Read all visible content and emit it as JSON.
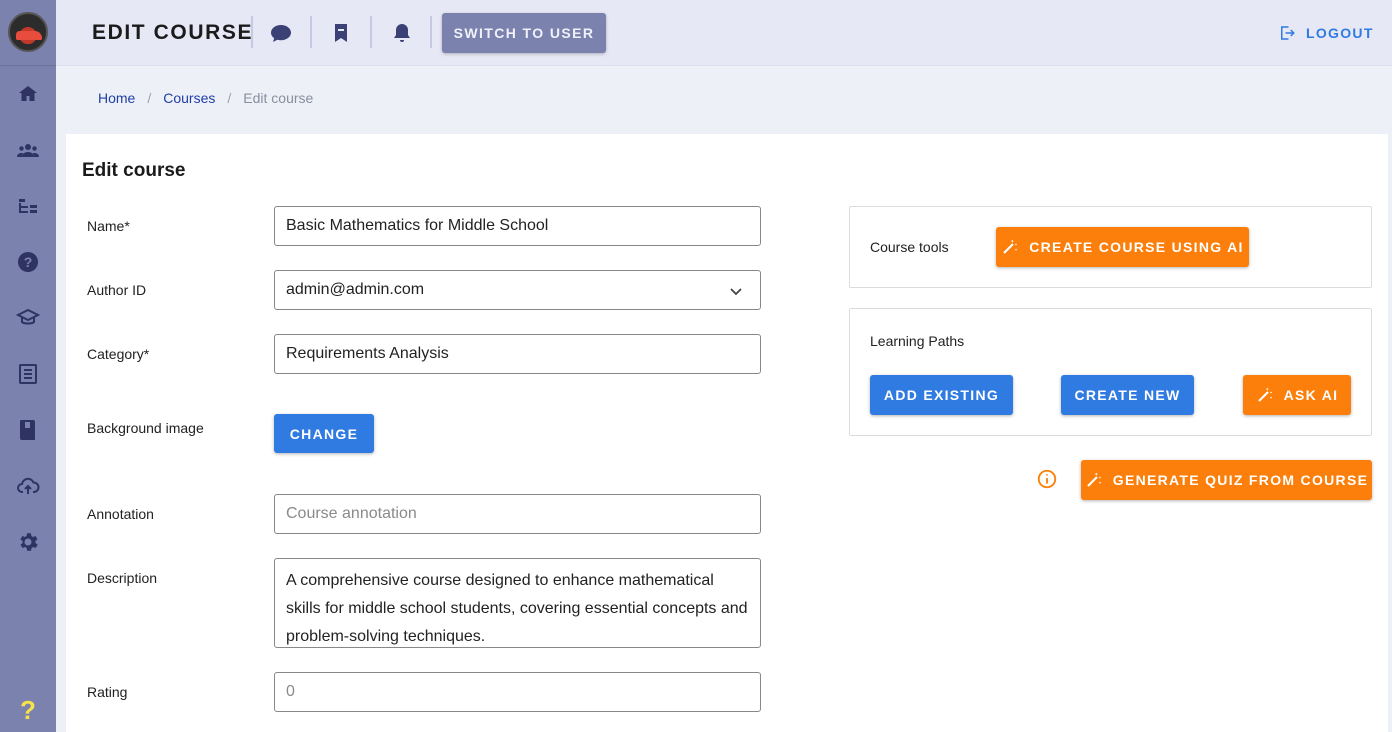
{
  "header": {
    "title": "EDIT COURSE",
    "switch_label": "SWITCH TO USER",
    "logout_label": "LOGOUT"
  },
  "sidebar": {
    "items": [
      "home-icon",
      "users-icon",
      "tree-icon",
      "help-circle-icon",
      "graduation-icon",
      "list-icon",
      "book-icon",
      "cloud-upload-icon",
      "gear-icon"
    ],
    "help_label": "?"
  },
  "breadcrumb": {
    "home": "Home",
    "sep": "/",
    "courses": "Courses",
    "current": "Edit course"
  },
  "form": {
    "title": "Edit course",
    "name_label": "Name*",
    "name_value": "Basic Mathematics for Middle School",
    "author_label": "Author ID",
    "author_value": "admin@admin.com",
    "category_label": "Category*",
    "category_value": "Requirements Analysis",
    "bg_label": "Background image",
    "change_label": "CHANGE",
    "annotation_label": "Annotation",
    "annotation_placeholder": "Course annotation",
    "description_label": "Description",
    "description_value": "A comprehensive course designed to enhance mathematical skills for middle school students, covering essential concepts and problem-solving techniques.",
    "rating_label": "Rating",
    "rating_placeholder": "0"
  },
  "tools": {
    "course_tools_label": "Course tools",
    "create_ai_label": "CREATE COURSE USING AI",
    "learning_paths_label": "Learning Paths",
    "add_existing_label": "ADD EXISTING",
    "create_new_label": "CREATE NEW",
    "ask_ai_label": "ASK AI",
    "generate_quiz_label": "GENERATE QUIZ FROM COURSE"
  },
  "colors": {
    "sidebar": "#7b82ad",
    "topbar": "#e7e8f6",
    "primary": "#2f7be2",
    "accent": "#fb7f0a",
    "help": "#f6e24a"
  }
}
